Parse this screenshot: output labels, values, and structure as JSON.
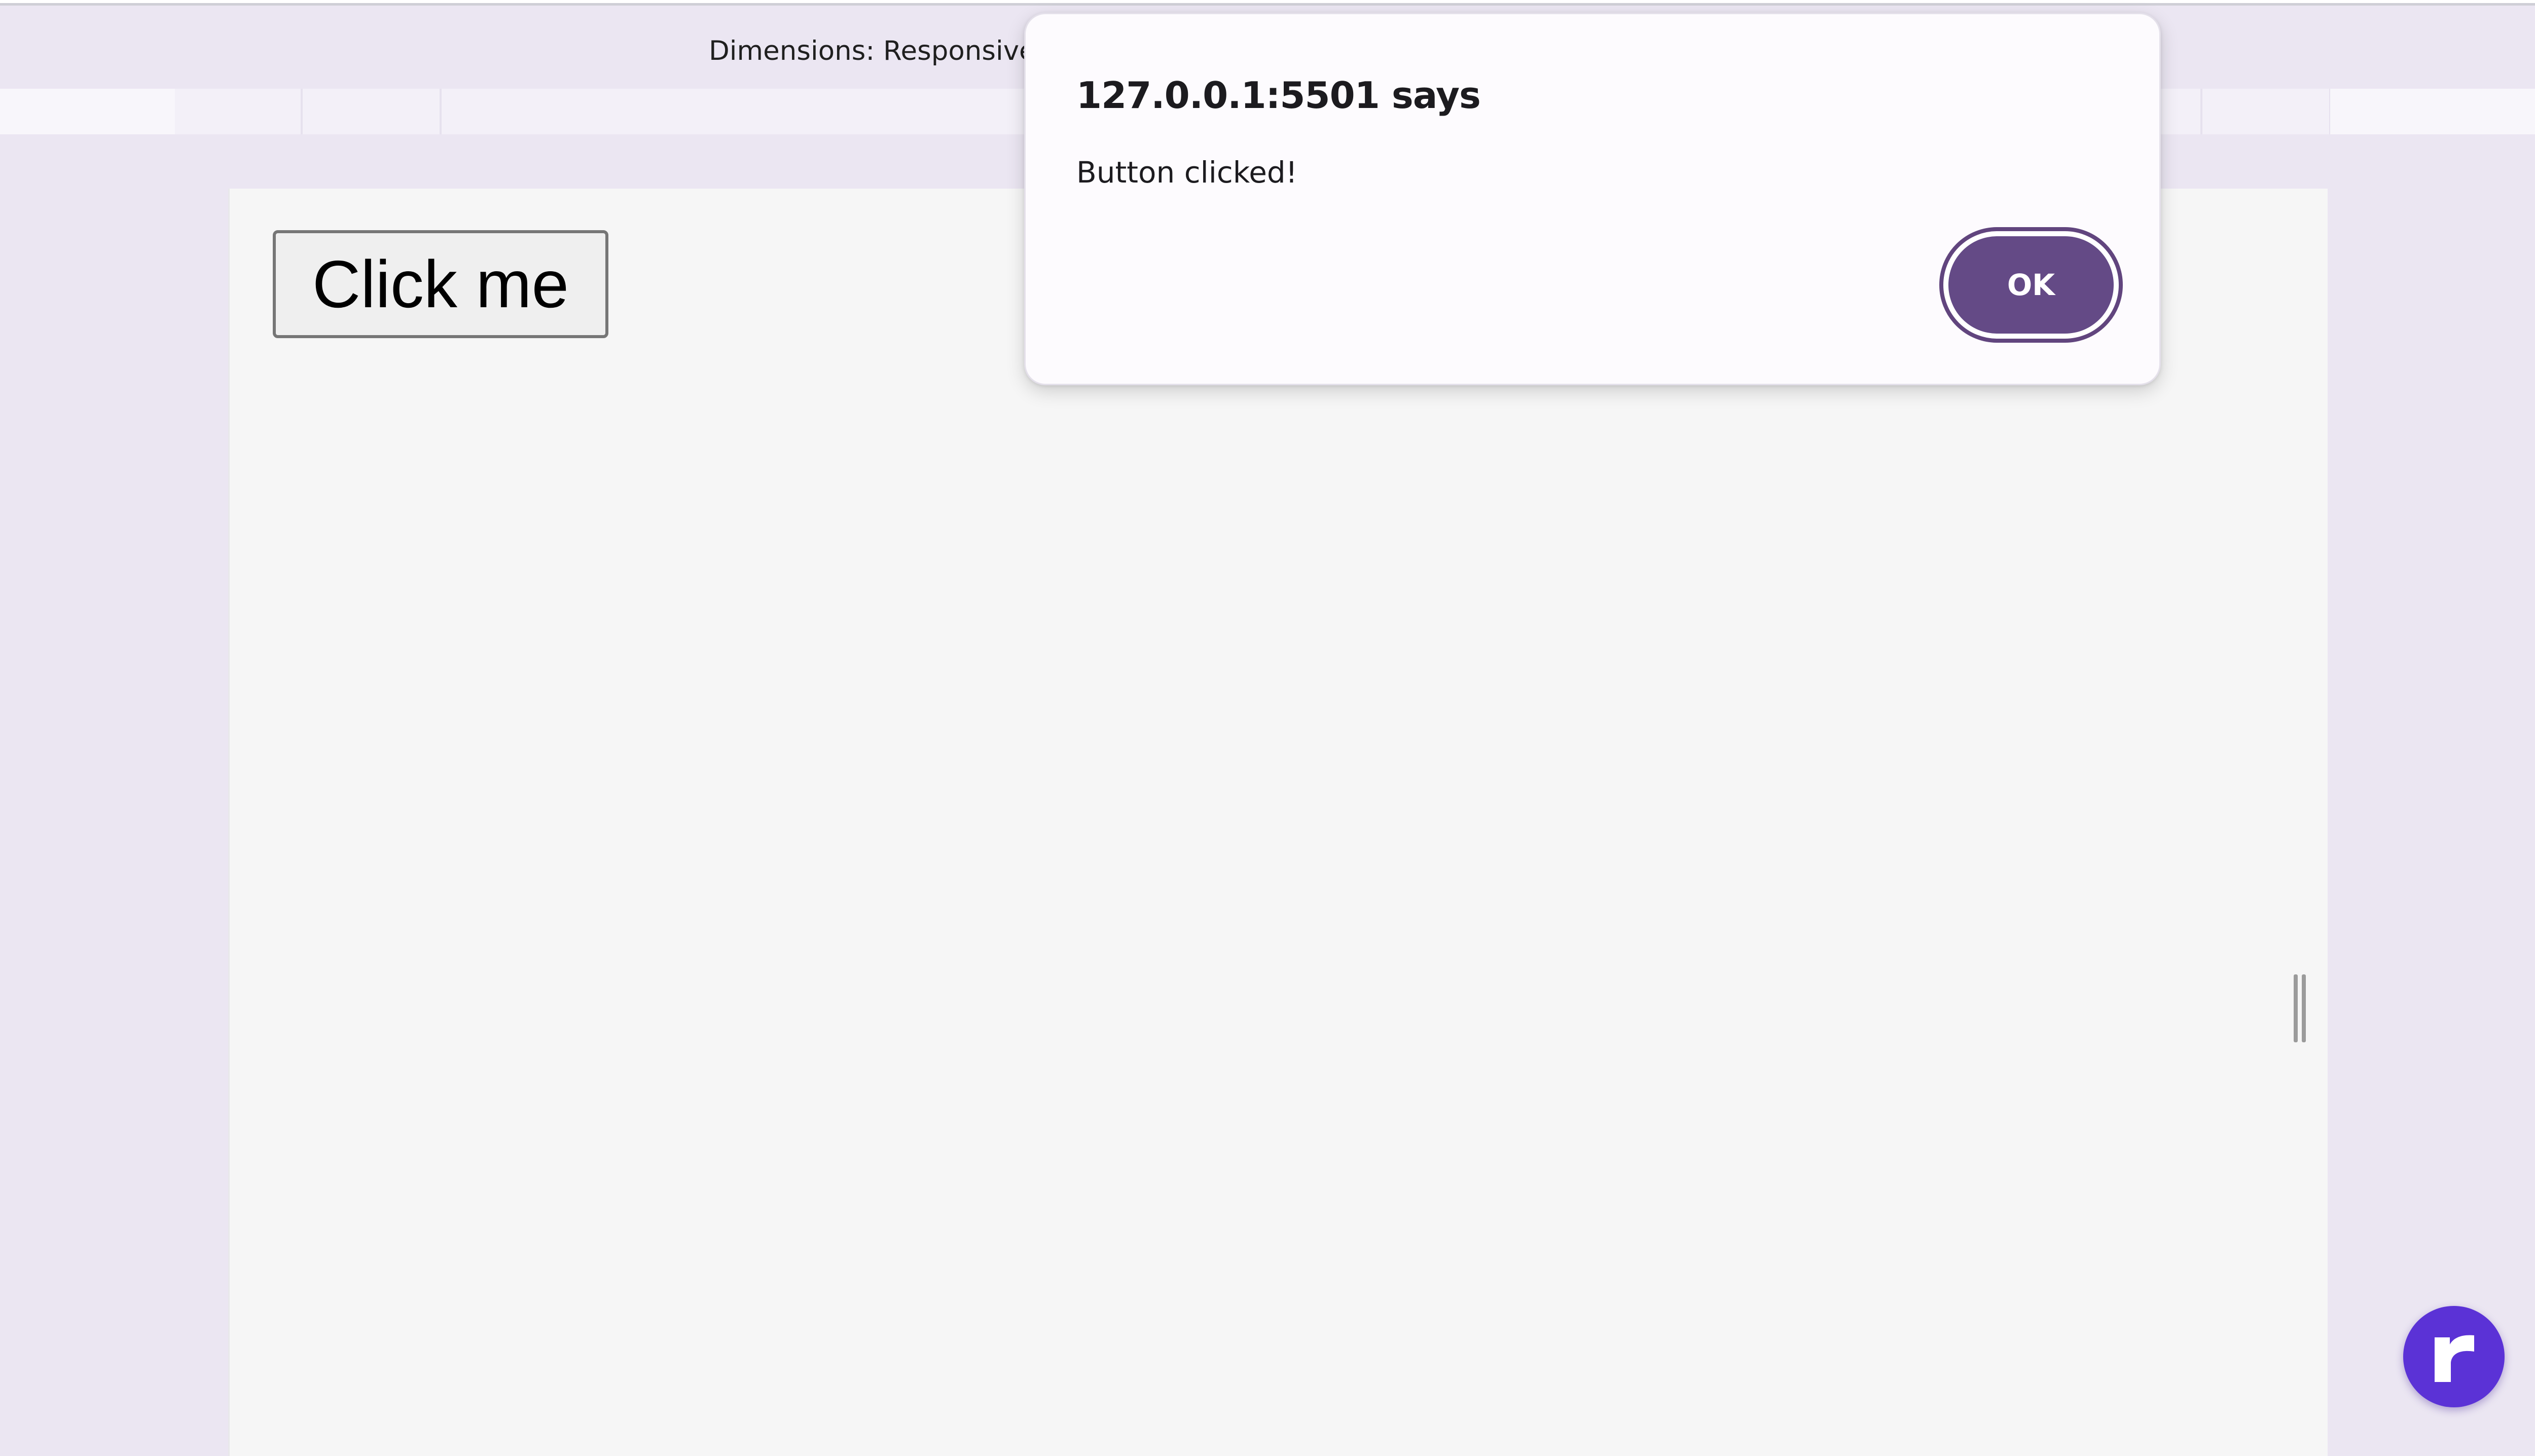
{
  "devtools": {
    "dimensions_label": "Dimensions: Responsive"
  },
  "page": {
    "button_label": "Click me"
  },
  "alert": {
    "title": "127.0.0.1:5501 says",
    "message": "Button clicked!",
    "ok_label": "OK",
    "accent_color": "#644a86"
  },
  "widget": {
    "icon": "r-logo-icon",
    "color": "#5b32d6"
  }
}
